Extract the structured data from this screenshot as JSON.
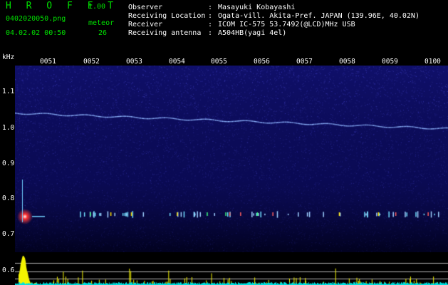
{
  "app": {
    "title": "H R O F F T",
    "version": "1.00"
  },
  "file": {
    "name": "0402020050.png",
    "timestamp": "04.02.02 00:50"
  },
  "meteor": {
    "label": "meteor",
    "count": "26"
  },
  "info": [
    {
      "key": "Observer",
      "value": "Masayuki Kobayashi"
    },
    {
      "key": "Receiving Location",
      "value": "Ogata-vill. Akita-Pref. JAPAN (139.96E, 40.02N)"
    },
    {
      "key": "Receiver",
      "value": "ICOM IC-575 53.7492(@LCD)MHz USB"
    },
    {
      "key": "Receiving antenna",
      "value": "A504HB(yagi 4el)"
    }
  ],
  "chart_data": {
    "type": "heatmap",
    "y_unit": "kHz",
    "y_ticks": [
      "1.1",
      "1.0",
      "0.9",
      "0.8",
      "0.7",
      "0.6"
    ],
    "x_ticks": [
      "0051",
      "0052",
      "0053",
      "0054",
      "0055",
      "0056",
      "0057",
      "0058",
      "0059",
      "0100"
    ],
    "colors": {
      "background": "#0b0b5a",
      "noise": "#2a2ac8",
      "carrier": "#8fb6ff",
      "meter": "#f4f400",
      "baseline": "#00e0e0"
    }
  }
}
